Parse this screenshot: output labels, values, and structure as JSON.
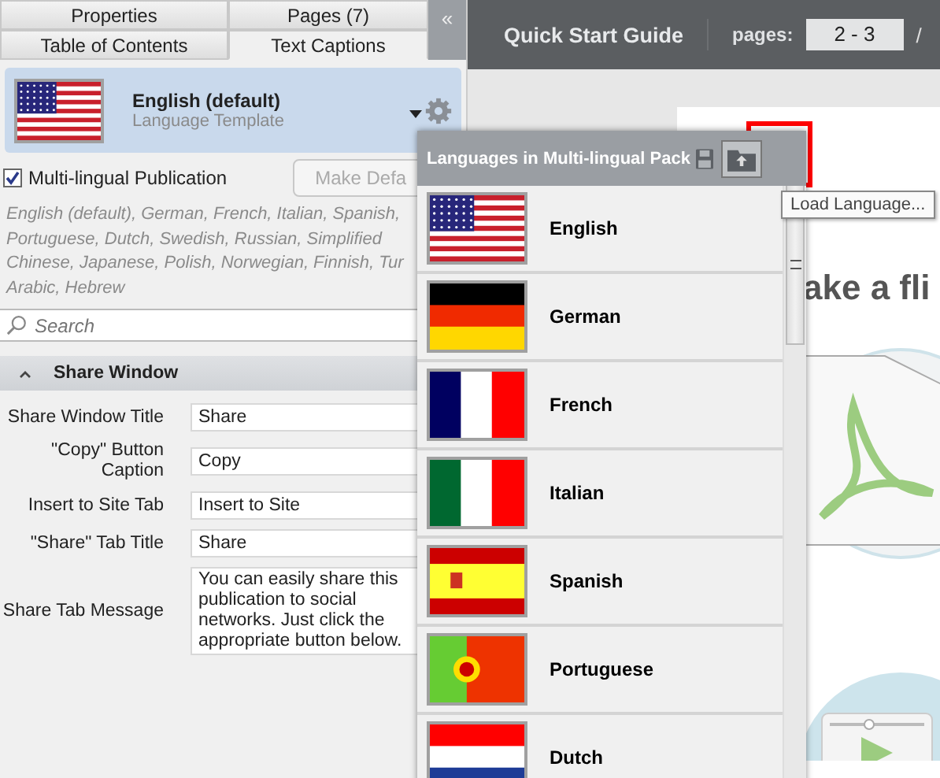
{
  "tabs_top": [
    {
      "label": "Properties",
      "selected": false
    },
    {
      "label": "Pages (7)",
      "selected": false
    }
  ],
  "tabs_bottom": [
    {
      "label": "Table of Contents",
      "selected": false
    },
    {
      "label": "Text Captions",
      "selected": true
    }
  ],
  "collapse_button": "«",
  "language": {
    "name": "English (default)",
    "subtitle": "Language Template",
    "kind": "us"
  },
  "multilingual": {
    "label": "Multi-lingual Publication",
    "checked": true
  },
  "make_default_button": "Make Defa",
  "languages_list": [
    "English (default), German, French, Italian, Spanish,",
    "Portuguese, Dutch, Swedish, Russian, Simplified",
    "Chinese, Japanese, Polish, Norwegian, Finnish, Tur",
    "Arabic, Hebrew"
  ],
  "search": {
    "placeholder": "Search"
  },
  "section": {
    "title": "Share Window",
    "expanded": true
  },
  "fields": [
    {
      "label": "Share Window Title",
      "value": "Share"
    },
    {
      "label": "\"Copy\" Button Caption",
      "value": "Copy"
    },
    {
      "label": "Insert to Site Tab",
      "value": "Insert to Site"
    },
    {
      "label": "\"Share\" Tab Title",
      "value": "Share"
    },
    {
      "label": "Share Tab Message",
      "value": "You can easily share this publication to social networks. Just click the appropriate button below.",
      "kind": "multiline"
    }
  ],
  "topbar": {
    "title": "Quick Start Guide",
    "pages_label": "pages:",
    "pages_value": "2 - 3",
    "separator": "/"
  },
  "page_heading": "ake a fli",
  "popup": {
    "title": "Languages in Multi-lingual Pack",
    "tooltip": "Load Language...",
    "items": [
      {
        "name": "English",
        "kind": "us"
      },
      {
        "name": "German",
        "kind": "de"
      },
      {
        "name": "French",
        "kind": "fr"
      },
      {
        "name": "Italian",
        "kind": "it"
      },
      {
        "name": "Spanish",
        "kind": "es"
      },
      {
        "name": "Portuguese",
        "kind": "pt"
      },
      {
        "name": "Dutch",
        "kind": "nl"
      }
    ]
  }
}
